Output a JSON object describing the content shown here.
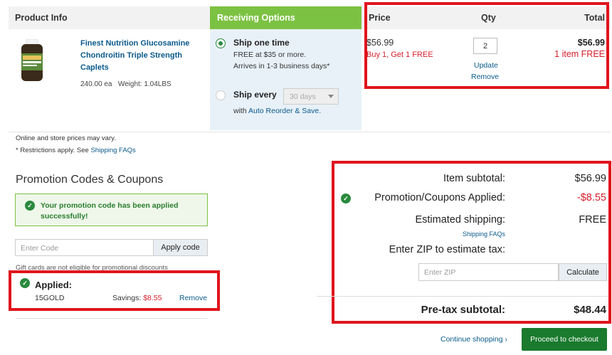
{
  "header": {
    "product_info": "Product Info",
    "receiving_options": "Receiving Options",
    "price": "Price",
    "qty": "Qty",
    "total": "Total"
  },
  "product": {
    "name_line1": "Finest Nutrition Glucosamine",
    "name_line2": "Chondroitin Triple Strength",
    "name_line3": "Caplets",
    "count": "240.00 ea",
    "weight": "Weight: 1.04LBS"
  },
  "receiving": {
    "ship_once_label": "Ship one time",
    "ship_once_line1": "FREE at $35 or more.",
    "ship_once_line2": "Arrives in 1-3 business days*",
    "ship_every_label": "Ship every",
    "interval_value": "30 days",
    "auto_reorder_prefix": "with ",
    "auto_reorder_link": "Auto Reorder & Save."
  },
  "line_item": {
    "price": "$56.99",
    "promo": "Buy 1, Get 1 FREE",
    "qty": "2",
    "update": "Update",
    "remove": "Remove",
    "total": "$56.99",
    "total_note": "1 item FREE"
  },
  "notes": {
    "prices_vary": "Online and store prices may vary.",
    "restrictions": "* Restrictions apply. See ",
    "shipping_faqs": "Shipping FAQs"
  },
  "promo": {
    "title": "Promotion Codes & Coupons",
    "success_line1": "Your promotion code has been applied",
    "success_line2": "successfully!",
    "input_placeholder": "Enter Code",
    "apply_button": "Apply code",
    "gift_note": "Gift cards are not eligible for promotional discounts",
    "applied_label": "Applied:",
    "applied_code": "15GOLD",
    "savings_label": "Savings: ",
    "savings_value": "$8.55",
    "remove": "Remove"
  },
  "summary": {
    "item_subtotal_label": "Item subtotal:",
    "item_subtotal_value": "$56.99",
    "promo_label": "Promotion/Coupons Applied:",
    "promo_value": "-$8.55",
    "shipping_label": "Estimated shipping:",
    "shipping_value": "FREE",
    "shipping_faqs": "Shipping FAQs",
    "zip_label": "Enter ZIP to estimate tax:",
    "zip_placeholder": "Enter ZIP",
    "calculate_button": "Calculate",
    "pretax_label": "Pre-tax subtotal:",
    "pretax_value": "$48.44"
  },
  "footer": {
    "continue_shopping": "Continue shopping ›",
    "checkout_button": "Proceed to checkout"
  },
  "colors": {
    "receiving_header": "#7cc242",
    "highlight_box": "#e0141c",
    "checkout_button": "#1a7a2d",
    "promo_red": "#d41f2b",
    "link": "#0a5a8c"
  }
}
